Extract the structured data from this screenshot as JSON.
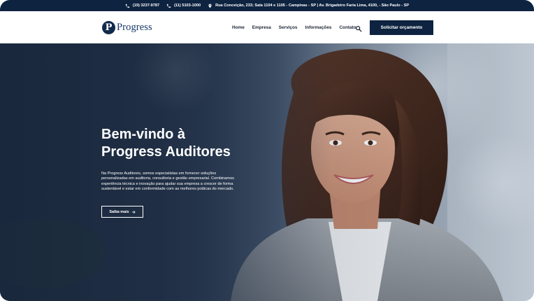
{
  "topbar": {
    "phone1": "(19) 3237-9787",
    "phone2": "(11) 5103-1000",
    "address": "Rua Conceição, 233; Sala 1104 e 1105 - Campinas - SP | Av. Brigadeiro Faria Lima, 4100, - São Paulo - SP",
    "phone_icon": "phone-icon",
    "location_icon": "map-pin-icon"
  },
  "header": {
    "logo_letter": "P",
    "logo_text": "Progress",
    "nav": [
      "Home",
      "Empresa",
      "Serviços",
      "Informações",
      "Contato"
    ],
    "search_icon": "search-icon",
    "cta_label": "Solicitar orçamento"
  },
  "hero": {
    "title_line1": "Bem-vindo à",
    "title_line2": "Progress Auditores",
    "paragraph": "Na Progress Auditores, somos especialistas em fornecer soluções personalizadas em auditoria, consultoria e gestão empresarial. Combinamos experiência técnica e inovação para ajudar sua empresa a crescer de forma sustentável e estar em conformidade com as melhores práticas do mercado.",
    "button_label": "Saiba mais",
    "button_icon": "arrow-right-icon"
  },
  "colors": {
    "navy": "#0e2340",
    "logo_blue": "#16386a",
    "white": "#ffffff"
  }
}
